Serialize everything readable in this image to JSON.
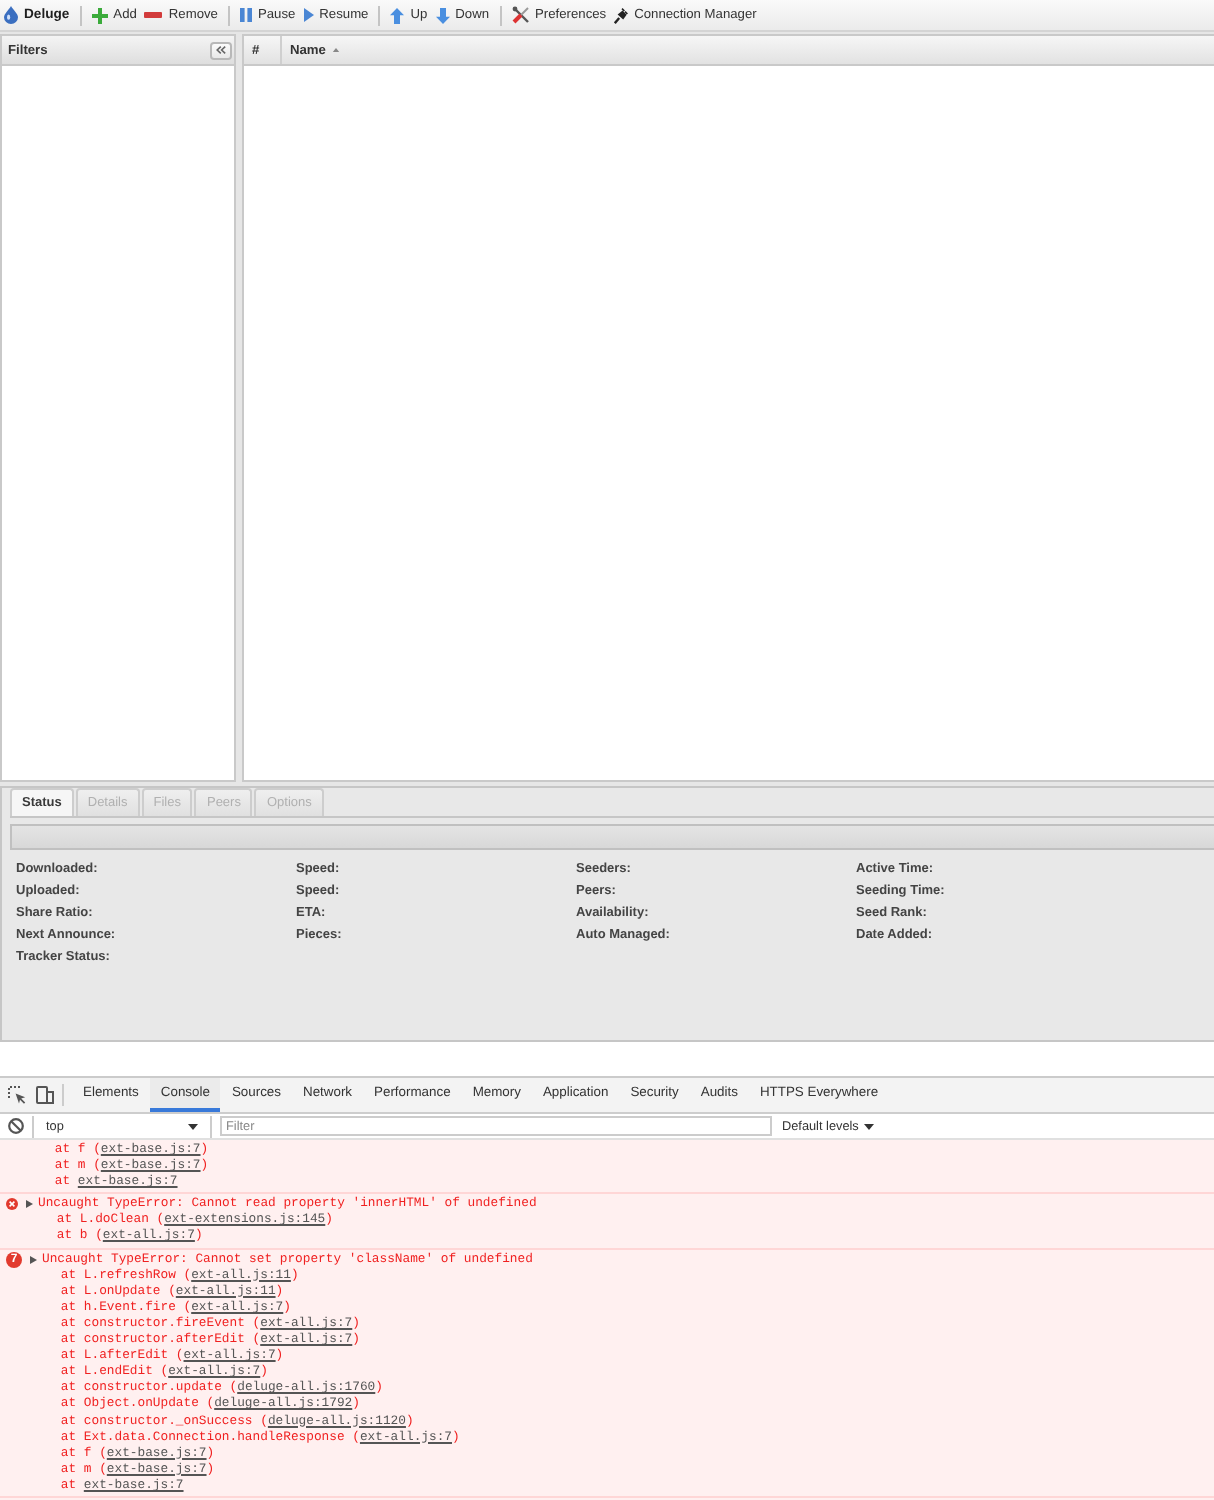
{
  "toolbar": {
    "title": "Deluge",
    "groups": [
      [
        {
          "kind": "add",
          "label": "Add"
        },
        {
          "kind": "remove",
          "label": "Remove"
        }
      ],
      [
        {
          "kind": "pause",
          "label": "Pause"
        },
        {
          "kind": "resume",
          "label": "Resume"
        }
      ],
      [
        {
          "kind": "up",
          "label": "Up"
        },
        {
          "kind": "down",
          "label": "Down"
        }
      ],
      [
        {
          "kind": "preferences",
          "label": "Preferences"
        },
        {
          "kind": "connection",
          "label": "Connection Manager"
        }
      ]
    ]
  },
  "filters": {
    "title": "Filters"
  },
  "torrents": {
    "columns": [
      {
        "label": "#",
        "sorted": false
      },
      {
        "label": "Name",
        "sorted": true
      }
    ]
  },
  "details": {
    "tabs": [
      {
        "label": "Status",
        "selected": true,
        "disabled": false
      },
      {
        "label": "Details",
        "selected": false,
        "disabled": true
      },
      {
        "label": "Files",
        "selected": false,
        "disabled": true
      },
      {
        "label": "Peers",
        "selected": false,
        "disabled": true
      },
      {
        "label": "Options",
        "selected": false,
        "disabled": true
      }
    ],
    "progress": {
      "level": 0
    },
    "fields": [
      [
        "Downloaded:",
        "Uploaded:",
        "Share Ratio:",
        "Next Announce:",
        "Tracker Status:"
      ],
      [
        "Speed:",
        "Speed:",
        "ETA:",
        "Pieces:"
      ],
      [
        "Seeders:",
        "Peers:",
        "Availability:",
        "Auto Managed:"
      ],
      [
        "Active Time:",
        "Seeding Time:",
        "Seed Rank:",
        "Date Added:"
      ]
    ]
  },
  "devtools": {
    "tabs": [
      {
        "label": "Elements",
        "selected": false
      },
      {
        "label": "Console",
        "selected": true
      },
      {
        "label": "Sources",
        "selected": false
      },
      {
        "label": "Network",
        "selected": false
      },
      {
        "label": "Performance",
        "selected": false
      },
      {
        "label": "Memory",
        "selected": false
      },
      {
        "label": "Application",
        "selected": false
      },
      {
        "label": "Security",
        "selected": false
      },
      {
        "label": "Audits",
        "selected": false
      },
      {
        "label": "HTTPS Everywhere",
        "selected": false
      }
    ],
    "console": {
      "context": "top",
      "filter": {
        "placeholder": "Filter"
      },
      "levels": "Default levels"
    },
    "messages": [
      {
        "lines": [
          {
            "prefix": "at f (",
            "link": "ext-base.js:7",
            "suffix": ")"
          },
          {
            "prefix": "at m (",
            "link": "ext-base.js:7",
            "suffix": ")"
          },
          {
            "prefix": "at ",
            "link": "ext-base.js:7"
          }
        ]
      },
      {
        "header": "Uncaught TypeError: Cannot read property 'innerHTML' of undefined",
        "expanded": false,
        "lines": [
          {
            "prefix": "at L.doClean (",
            "link": "ext-extensions.js:145",
            "suffix": ")"
          },
          {
            "prefix": "at b (",
            "link": "ext-all.js:7",
            "suffix": ")"
          }
        ]
      },
      {
        "header": "Uncaught TypeError: Cannot set property 'className' of undefined",
        "count": "7",
        "expanded": false,
        "lines": [
          {
            "prefix": "at L.refreshRow (",
            "link": "ext-all.js:11",
            "suffix": ")"
          },
          {
            "prefix": "at L.onUpdate (",
            "link": "ext-all.js:11",
            "suffix": ")"
          },
          {
            "prefix": "at h.Event.fire (",
            "link": "ext-all.js:7",
            "suffix": ")"
          },
          {
            "prefix": "at constructor.fireEvent (",
            "link": "ext-all.js:7",
            "suffix": ")"
          },
          {
            "prefix": "at constructor.afterEdit (",
            "link": "ext-all.js:7",
            "suffix": ")"
          },
          {
            "prefix": "at L.afterEdit (",
            "link": "ext-all.js:7",
            "suffix": ")"
          },
          {
            "prefix": "at L.endEdit (",
            "link": "ext-all.js:7",
            "suffix": ")"
          },
          {
            "prefix": "at constructor.update (",
            "link": "deluge-all.js:1760",
            "suffix": ")"
          },
          {
            "prefix": "at Object.onUpdate (",
            "link": "deluge-all.js:1792",
            "suffix": ")"
          },
          {
            "prefix": "at constructor._onSuccess (",
            "link": "deluge-all.js:1120",
            "suffix": ")"
          },
          {
            "prefix": "at Ext.data.Connection.handleResponse (",
            "link": "ext-all.js:7",
            "suffix": ")"
          },
          {
            "prefix": "at f (",
            "link": "ext-base.js:7",
            "suffix": ")"
          },
          {
            "prefix": "at m (",
            "link": "ext-base.js:7",
            "suffix": ")"
          },
          {
            "prefix": "at ",
            "link": "ext-base.js:7"
          }
        ]
      }
    ]
  }
}
